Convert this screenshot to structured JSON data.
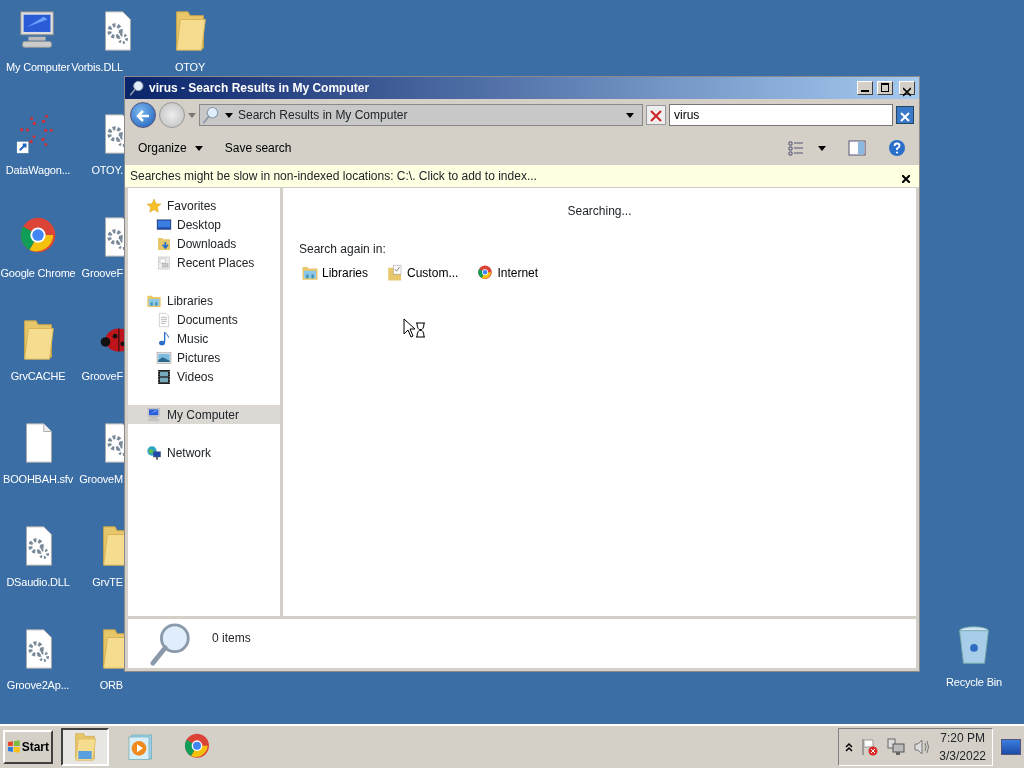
{
  "desktop": {
    "columns": [
      [
        {
          "label": "My Computer",
          "kind": "computer"
        },
        {
          "label": "DataWagon...",
          "kind": "dots"
        },
        {
          "label": "Google Chrome",
          "kind": "browser"
        },
        {
          "label": "GrvCACHE",
          "kind": "folder"
        },
        {
          "label": "BOOHBAH.sfv",
          "kind": "file"
        },
        {
          "label": "DSaudio.DLL",
          "kind": "dll"
        },
        {
          "label": "Groove2Ap...",
          "kind": "dll"
        }
      ],
      [
        {
          "label": "Vorbis.DLL",
          "kind": "dll"
        },
        {
          "label": "OTOY.",
          "kind": "dll"
        },
        {
          "label": "GrooveF",
          "kind": "dll"
        },
        {
          "label": "GrooveF",
          "kind": "ladybug"
        },
        {
          "label": "GrooveM",
          "kind": "dll"
        },
        {
          "label": "GrvTE",
          "kind": "folder"
        },
        {
          "label": "ORB",
          "kind": "folder"
        }
      ],
      [
        {
          "label": "OTOY",
          "kind": "folder"
        }
      ]
    ],
    "recycle": {
      "label": "Recycle Bin",
      "kind": "trash"
    }
  },
  "window": {
    "title": "virus - Search Results in My Computer",
    "address": "Search Results in My Computer",
    "search": {
      "value": "virus"
    },
    "toolbar": [
      {
        "label": "Organize",
        "dropdown": true
      },
      {
        "label": "Save search",
        "dropdown": false
      }
    ],
    "info_bar": "Searches might be slow in non-indexed locations: C:\\. Click to add to index...",
    "nav": [
      {
        "label": "Favorites",
        "kind": "star",
        "selected": false,
        "children": [
          {
            "label": "Desktop",
            "kind": "desktop",
            "selected": false
          },
          {
            "label": "Downloads",
            "kind": "downloads",
            "selected": false
          },
          {
            "label": "Recent Places",
            "kind": "recent",
            "selected": false
          }
        ]
      },
      {
        "label": "Libraries",
        "kind": "library",
        "selected": false,
        "children": [
          {
            "label": "Documents",
            "kind": "documents",
            "selected": false
          },
          {
            "label": "Music",
            "kind": "music",
            "selected": false
          },
          {
            "label": "Pictures",
            "kind": "pictures",
            "selected": false
          },
          {
            "label": "Videos",
            "kind": "videos",
            "selected": false
          }
        ]
      },
      {
        "label": "My Computer",
        "kind": "computer",
        "selected": true
      },
      {
        "label": "Network",
        "kind": "network",
        "selected": false
      }
    ],
    "status": "Searching...",
    "search_again_label": "Search again in:",
    "search_again": [
      {
        "label": "Libraries",
        "kind": "library"
      },
      {
        "label": "Custom...",
        "kind": "custom"
      },
      {
        "label": "Internet",
        "kind": "browser"
      }
    ],
    "details": "0 items"
  },
  "taskbar": {
    "start": "Start",
    "apps": [
      {
        "kind": "explorer",
        "selected": true
      },
      {
        "kind": "player",
        "selected": false
      },
      {
        "kind": "browser",
        "selected": false
      }
    ],
    "time": "7:20 PM",
    "date": "3/3/2022"
  }
}
